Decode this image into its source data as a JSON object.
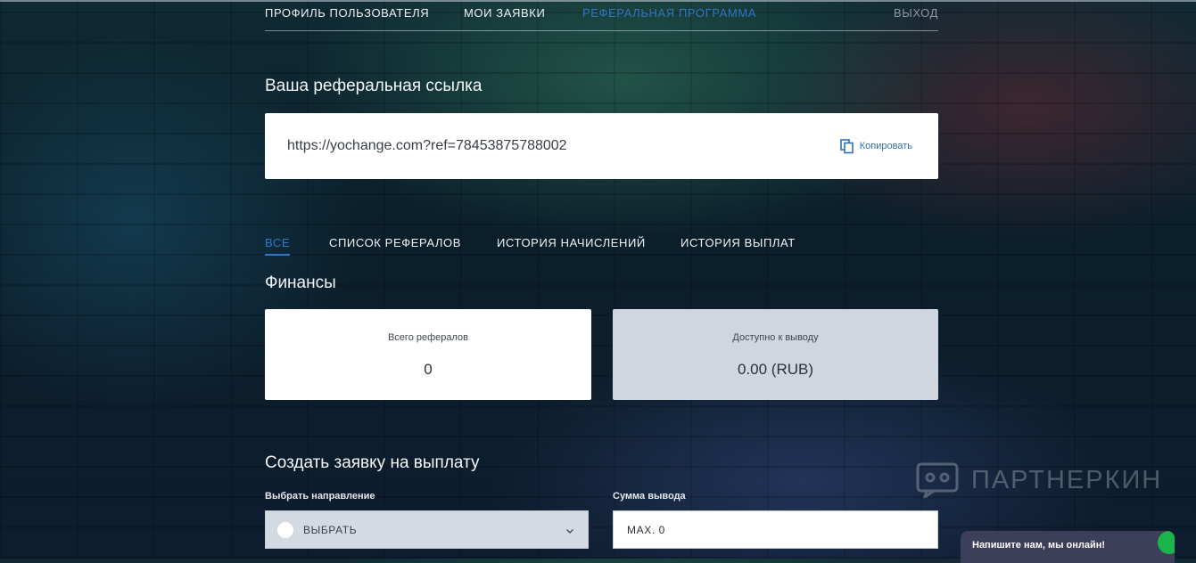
{
  "nav": {
    "profile": "ПРОФИЛЬ ПОЛЬЗОВАТЕЛЯ",
    "orders": "МОИ ЗАЯВКИ",
    "referral": "РЕФЕРАЛЬНАЯ ПРОГРАММА",
    "logout": "ВЫХОД",
    "active": "referral"
  },
  "referral_link": {
    "title": "Ваша реферальная ссылка",
    "url": "https://yochange.com?ref=78453875788002",
    "copy_label": "Копировать",
    "copy_icon": "copy-icon"
  },
  "tabs": {
    "all": "ВСЕ",
    "referral_list": "СПИСОК РЕФЕРАЛОВ",
    "accrual_history": "ИСТОРИЯ НАЧИСЛЕНИЙ",
    "payout_history": "ИСТОРИЯ ВЫПЛАТ",
    "active": "all"
  },
  "finance": {
    "title": "Финансы",
    "total_referrals_label": "Всего рефералов",
    "total_referrals_value": "0",
    "available_label": "Доступно к выводу",
    "available_value": "0.00 (RUB)"
  },
  "payout": {
    "title": "Создать заявку на выплату",
    "direction_label": "Выбрать направление",
    "direction_value": "ВЫБРАТЬ",
    "amount_label": "Сумма вывода",
    "amount_placeholder": "MAX. 0"
  },
  "watermark": {
    "text": "ПАРТНЕРКИН"
  },
  "chat": {
    "text": "Напишите нам, мы онлайн!"
  },
  "colors": {
    "accent": "#2e78c6",
    "card_bg": "#ffffff",
    "muted_card_bg": "#cfd6df",
    "chat_bg": "#3c3e5a",
    "online_dot": "#1bb54b"
  }
}
